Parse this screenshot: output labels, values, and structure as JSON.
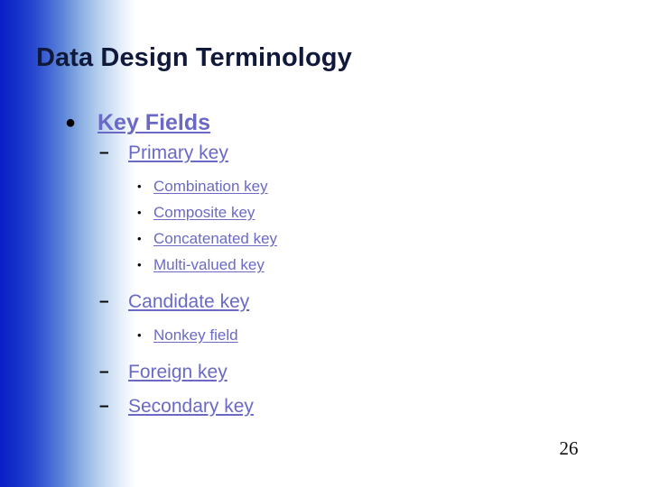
{
  "slide": {
    "title": "Data Design Terminology",
    "page_number": "26",
    "colors": {
      "title_text": "#10193a",
      "body_text": "#6a6ac6",
      "bullet_glyph": "#000000",
      "gradient_start": "#0b1fc6",
      "gradient_end": "#ffffff",
      "background": "#ffffff"
    },
    "outline": [
      {
        "level": 1,
        "bullet_glyph": "●",
        "bullet_name": "filled-circle-bullet",
        "label": "Key Fields"
      },
      {
        "level": 2,
        "bullet_glyph": "–",
        "bullet_name": "en-dash-bullet",
        "label": "Primary key"
      },
      {
        "level": 3,
        "bullet_glyph": "•",
        "bullet_name": "small-dot-bullet",
        "label": "Combination key"
      },
      {
        "level": 3,
        "bullet_glyph": "•",
        "bullet_name": "small-dot-bullet",
        "label": "Composite key"
      },
      {
        "level": 3,
        "bullet_glyph": "•",
        "bullet_name": "small-dot-bullet",
        "label": "Concatenated key"
      },
      {
        "level": 3,
        "bullet_glyph": "•",
        "bullet_name": "small-dot-bullet",
        "label": "Multi-valued key"
      },
      {
        "level": 2,
        "bullet_glyph": "–",
        "bullet_name": "en-dash-bullet",
        "label": "Candidate key"
      },
      {
        "level": 3,
        "bullet_glyph": "•",
        "bullet_name": "small-dot-bullet",
        "label": "Nonkey field"
      },
      {
        "level": 2,
        "bullet_glyph": "–",
        "bullet_name": "en-dash-bullet",
        "label": "Foreign key"
      },
      {
        "level": 2,
        "bullet_glyph": "–",
        "bullet_name": "en-dash-bullet",
        "label": "Secondary key"
      }
    ]
  }
}
